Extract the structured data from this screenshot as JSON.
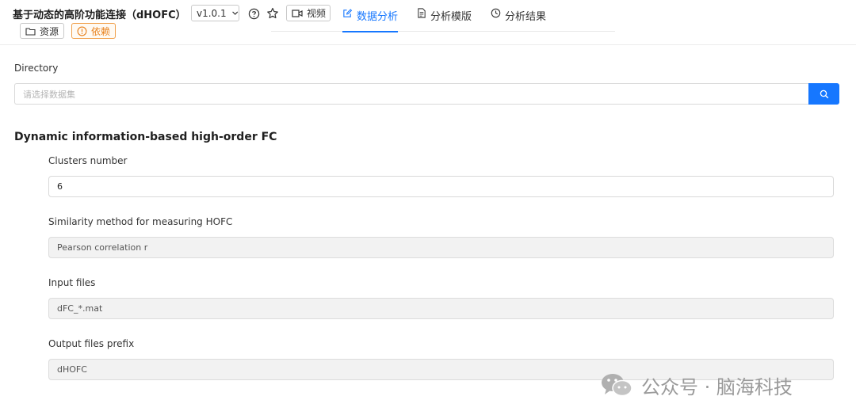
{
  "header": {
    "title": "基于动态的高阶功能连接（dHOFC）",
    "version": "v1.0.1",
    "video_label": "视频",
    "resources_label": "资源",
    "dependencies_label": "依赖"
  },
  "tabs": [
    {
      "label": "数据分析",
      "icon": "edit-icon",
      "active": true
    },
    {
      "label": "分析模版",
      "icon": "file-icon",
      "active": false
    },
    {
      "label": "分析结果",
      "icon": "clock-icon",
      "active": false
    }
  ],
  "directory": {
    "label": "Directory",
    "placeholder": "请选择数据集"
  },
  "section": {
    "title": "Dynamic information-based high-order FC",
    "fields": [
      {
        "label": "Clusters number",
        "value": "6"
      },
      {
        "label": "Similarity method for measuring HOFC",
        "value": "Pearson correlation r"
      },
      {
        "label": "Input files",
        "value": "dFC_*.mat"
      },
      {
        "label": "Output files prefix",
        "value": "dHOFC"
      }
    ]
  },
  "watermark": {
    "text": "公众号 · 脑海科技"
  },
  "colors": {
    "accent": "#1677ff",
    "warning": "#e8821e"
  }
}
